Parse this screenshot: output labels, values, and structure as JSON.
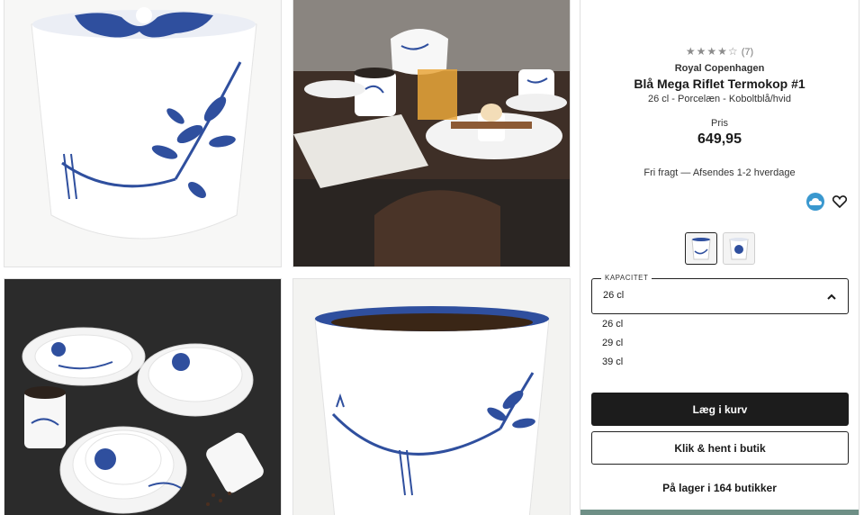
{
  "product": {
    "rating_count": "(7)",
    "brand": "Royal Copenhagen",
    "title": "Blå Mega Riflet Termokop #1",
    "subtitle": "26 cl - Porcelæn - Koboltblå/hvid",
    "price_label": "Pris",
    "price": "649,95",
    "shipping": "Fri fragt — Afsendes 1-2 hverdage"
  },
  "icons": {
    "rating": "star-rating-icon",
    "badge": "cloud-badge-icon",
    "favorite": "heart-icon",
    "dropdown": "chevron-up-icon"
  },
  "capacity": {
    "label": "KAPACITET",
    "selected": "26 cl",
    "options": [
      "26 cl",
      "29 cl",
      "39 cl"
    ]
  },
  "actions": {
    "add_to_cart": "Læg i kurv",
    "click_collect": "Klik & hent i butik",
    "stock": "På lager i 164 butikker"
  },
  "colors": {
    "cobalt": "#2f4f9e",
    "button_dark": "#1c1c1c",
    "badge_blue": "#3a98cf",
    "bar_green": "#6e8f86"
  }
}
